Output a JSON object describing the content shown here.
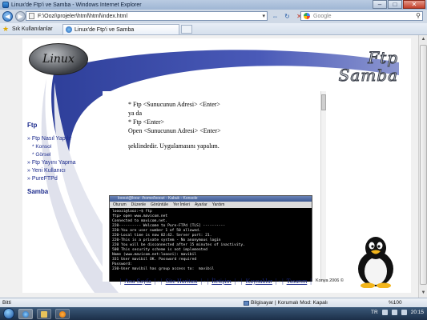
{
  "window": {
    "title": "Linux'de Ftp'i ve Samba - Windows Internet Explorer",
    "controls": {
      "minimize": "–",
      "maximize": "□",
      "close": "✕"
    }
  },
  "address": {
    "url": "F:\\Oozi\\projeler\\html\\html\\index.html"
  },
  "search": {
    "placeholder": "Google"
  },
  "favorites": {
    "label": "Sık Kullanılanlar",
    "tab_label": "Linux'de Ftp'i ve Samba"
  },
  "site": {
    "logo_text": "Linux",
    "header_line1": "Ftp",
    "header_line2": "Samba",
    "sidebar": {
      "section1": "Ftp",
      "items": [
        {
          "label": "» Ftp Nasıl Yapılır",
          "sub": [
            "* Konsol",
            "* Görsel"
          ]
        },
        {
          "label": "» Ftp Yayını Yapma",
          "sub": []
        },
        {
          "label": "» Yeni Kullanıcı",
          "sub": []
        },
        {
          "label": "» PureFTPd",
          "sub": []
        }
      ],
      "section2": "Samba"
    },
    "article": {
      "line1": "* Ftp <Sunucunun Adresi> <Enter>",
      "line2": "ya da",
      "line3": "* Ftp <Enter>",
      "line4": "Open <Sunucunun Adresi> <Enter>",
      "line5": "şeklindedir. Uygulamasını yapalım."
    },
    "terminal": {
      "title": "looozi@looz: /home/looozi - Kabuk - Konsole",
      "menu": [
        "Oturum",
        "Düzenle",
        "Görüntüle",
        "Yer İmleri",
        "Ayarlar",
        "Yardım"
      ],
      "lines": [
        "looozi@looz:~$ ftp",
        "ftp> open www.mavicom.net",
        "Connected to mavicom.net.",
        "220---------- Welcome to Pure-FTPd [TLS] ----------",
        "220-You are user number 1 of 50 allowed.",
        "220-Local time is now 02:42. Server port: 21.",
        "220-This is a private system - No anonymous login",
        "220 You will be disconnected after 15 minutes of inactivity.",
        "500 This security scheme is not implemented",
        "Name (www.mavicom.net:looozi): mavibil",
        "331 User mavibil OK. Password required",
        "Password:",
        "230-User mavibil has group access to:  mavibil"
      ]
    },
    "footer": {
      "links": [
        "Ana Sayfa",
        "Site Haritası",
        "İletişim",
        "Kaynaklar",
        "Tasarım"
      ]
    },
    "copyright": "Konya 2006 ©"
  },
  "statusbar": {
    "left": "Bitti",
    "zone": "Bilgisayar | Korumalı Mod: Kapalı",
    "zoom": "%100"
  },
  "taskbar": {
    "lang": "TR",
    "clock": "20:15"
  },
  "colors": {
    "link_blue": "#1b2a8c",
    "swoosh": "#3a4aa8",
    "titlebar": "#b9cbe2"
  }
}
